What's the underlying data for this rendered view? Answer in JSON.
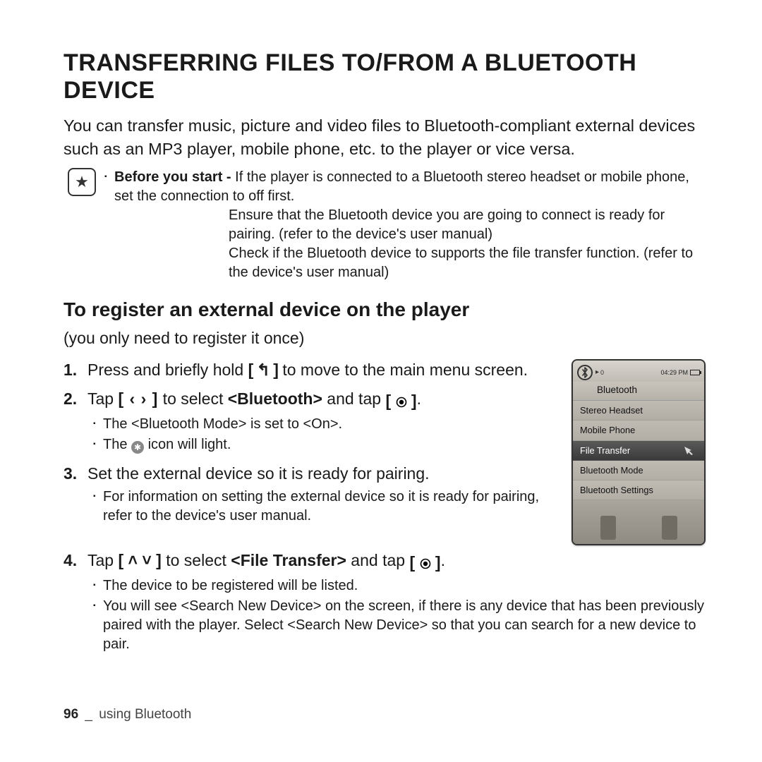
{
  "title": "TRANSFERRING FILES TO/FROM A BLUETOOTH DEVICE",
  "intro": "You can transfer music, picture and video files to Bluetooth-compliant external devices such as an MP3 player, mobile phone, etc. to the player or vice versa.",
  "note": {
    "lead": "Before you start - ",
    "first": "If the player is connected to a Bluetooth stereo headset or mobile phone, set the connection to off first.",
    "lines": [
      "Ensure that the Bluetooth device you are going to connect is ready for pairing. (refer to the device's user manual)",
      "Check if the Bluetooth device to supports the file transfer function. (refer to the device's user manual)"
    ]
  },
  "subheading": "To register an external device on the player",
  "paren": "(you only need to register it once)",
  "buttons": {
    "back": "[ ↰ ]",
    "lr": "[ ‹  › ]",
    "ud": "[ ˄ ˅ ]",
    "sel": "[ ◉ ]"
  },
  "steps": [
    {
      "pre": "Press and briefly hold ",
      "btn": "back",
      "post": " to move to the main menu screen.",
      "bullets": []
    },
    {
      "pre": "Tap ",
      "btn": "lr",
      "mid": " to select ",
      "bold": "<Bluetooth>",
      "mid2": " and tap ",
      "btn2": "sel",
      "post": ".",
      "bullets": [
        "The <Bluetooth Mode> is set to <On>.",
        "__BT__ icon will light."
      ]
    },
    {
      "pre": "Set the external device so it is ready for pairing.",
      "bullets": [
        "For information on setting the external device so it is ready for pairing, refer to the device's user manual."
      ]
    },
    {
      "pre": "Tap ",
      "btn": "ud",
      "mid": " to select ",
      "bold": "<File Transfer>",
      "mid2": " and tap ",
      "btn2": "sel",
      "post": ".",
      "bullets": [
        "The device to be registered will be listed.",
        "You will see <Search New Device> on the screen, if there is any device that has been previously paired with the player. Select <Search New Device> so that you can search for a new device to pair."
      ],
      "full_width": true
    }
  ],
  "device": {
    "time": "04:29 PM",
    "title": "Bluetooth",
    "items": [
      {
        "label": "Stereo Headset",
        "selected": false
      },
      {
        "label": "Mobile Phone",
        "selected": false
      },
      {
        "label": "File Transfer",
        "selected": true
      },
      {
        "label": "Bluetooth Mode",
        "selected": false
      },
      {
        "label": "Bluetooth Settings",
        "selected": false
      }
    ]
  },
  "footer": {
    "page": "96",
    "sep": "_",
    "section": "using Bluetooth"
  }
}
